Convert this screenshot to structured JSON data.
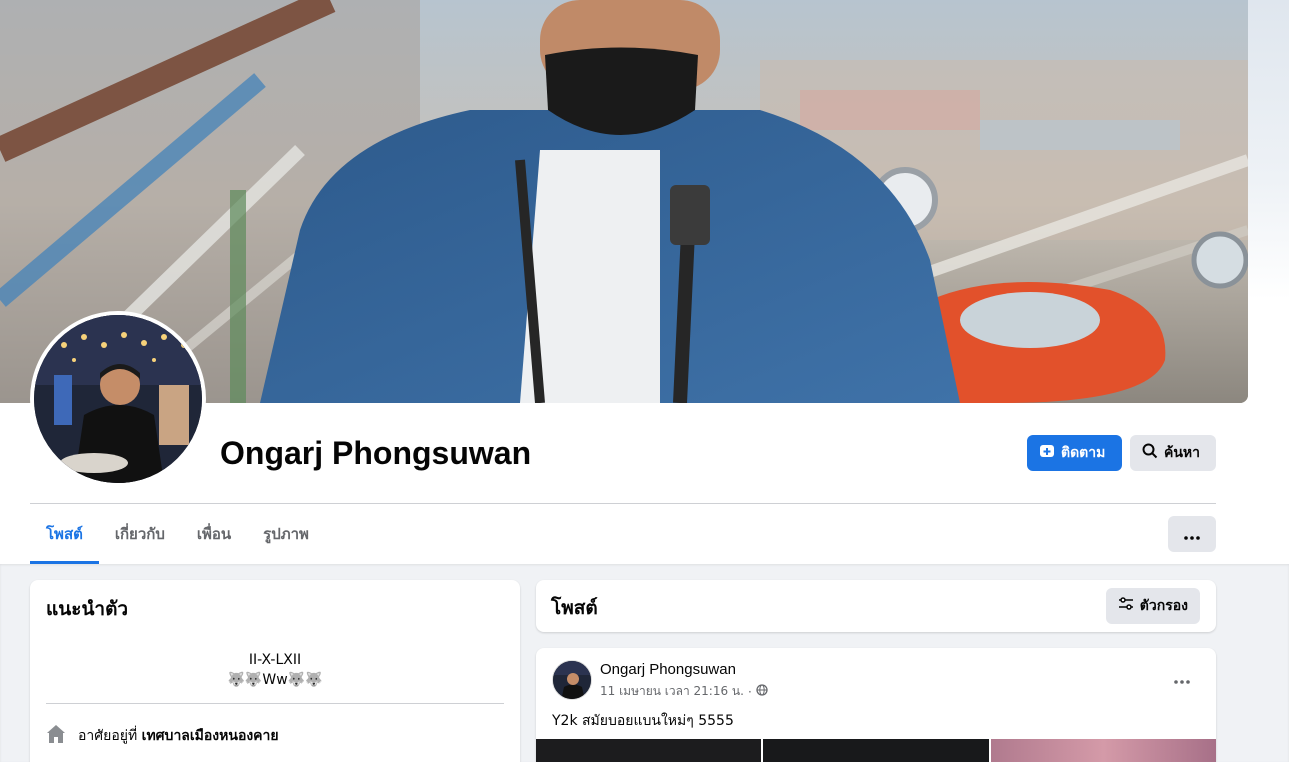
{
  "profile": {
    "name": "Ongarj Phongsuwan",
    "follow_label": "ติดตาม",
    "search_label": "ค้นหา"
  },
  "tabs": [
    {
      "label": "โพสต์",
      "active": true
    },
    {
      "label": "เกี่ยวกับ",
      "active": false
    },
    {
      "label": "เพื่อน",
      "active": false
    },
    {
      "label": "รูปภาพ",
      "active": false
    }
  ],
  "intro": {
    "title": "แนะนำตัว",
    "bio_line1": "II-X-LXII",
    "bio_line2": "🐺🐺Ww🐺🐺",
    "lives_prefix": "อาศัยอยู่ที่",
    "lives_place": "เทศบาลเมืองหนองคาย"
  },
  "posts_header": {
    "title": "โพสต์",
    "filter_label": "ตัวกรอง"
  },
  "post": {
    "author": "Ongarj Phongsuwan",
    "timestamp": "11 เมษายน เวลา 21:16 น.",
    "separator": "·",
    "text": "Y2k สมัยบอยแบนใหม่ๆ 5555"
  },
  "colors": {
    "accent": "#1b74e4",
    "secondary_button": "#e4e6eb",
    "page_bg": "#f0f2f5"
  },
  "icons": {
    "follow": "person-add-icon",
    "search": "search-icon",
    "more": "more-dots-icon",
    "filter": "filter-sliders-icon",
    "home": "home-icon",
    "audience": "globe-icon"
  }
}
